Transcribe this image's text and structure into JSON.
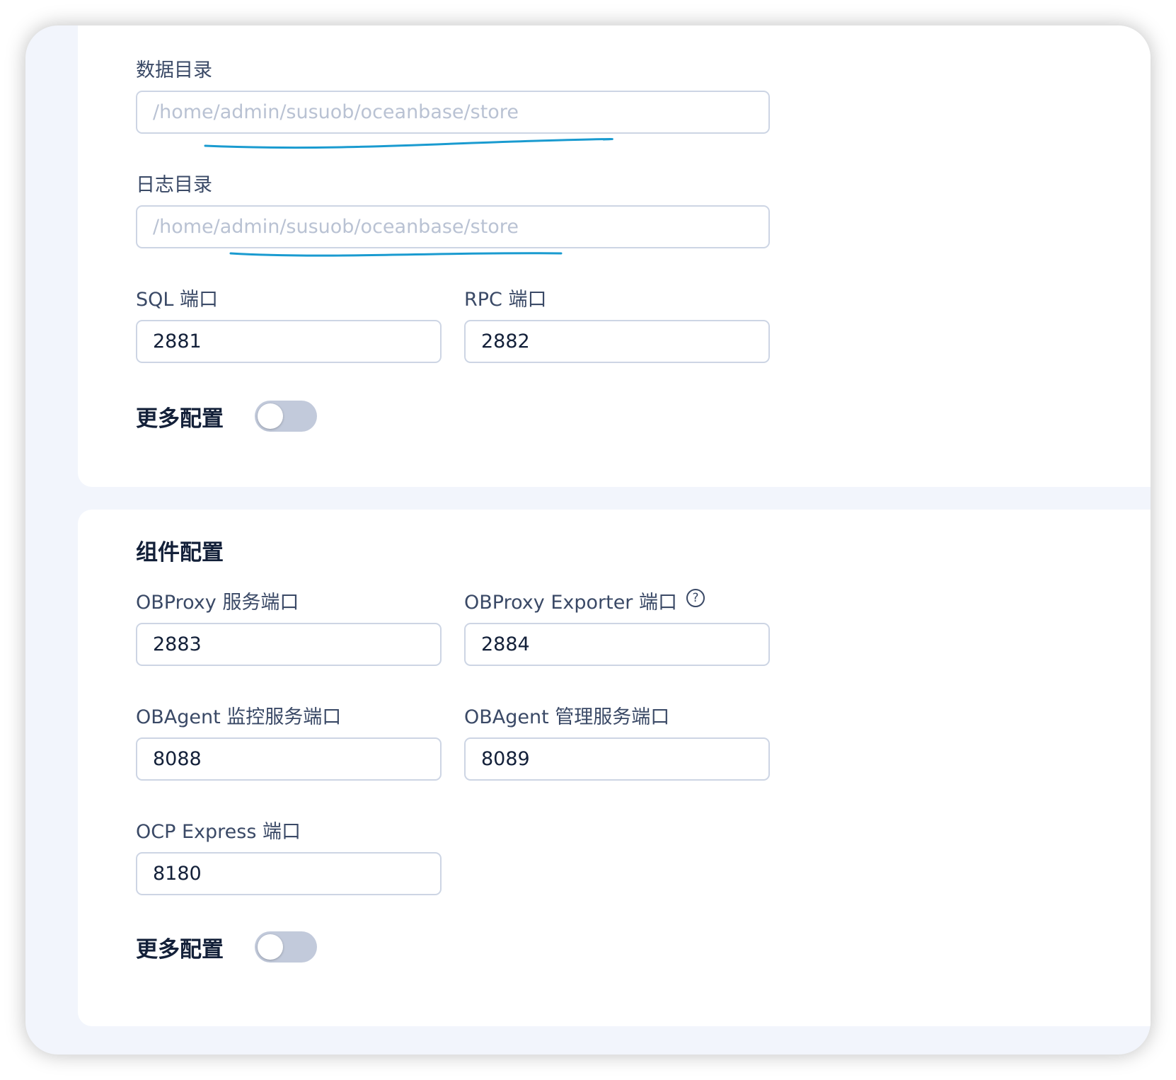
{
  "storage": {
    "data_dir": {
      "label": "数据目录",
      "placeholder": "/home/admin/susuob/oceanbase/store"
    },
    "log_dir": {
      "label": "日志目录",
      "placeholder": "/home/admin/susuob/oceanbase/store"
    },
    "sql_port": {
      "label": "SQL 端口",
      "value": "2881"
    },
    "rpc_port": {
      "label": "RPC 端口",
      "value": "2882"
    },
    "more_config": {
      "label": "更多配置",
      "enabled": false
    }
  },
  "components": {
    "title": "组件配置",
    "obproxy_port": {
      "label": "OBProxy 服务端口",
      "value": "2883"
    },
    "obproxy_exporter_port": {
      "label": "OBProxy Exporter 端口",
      "value": "2884",
      "icon": "question-circle-icon"
    },
    "obagent_monitor_port": {
      "label": "OBAgent 监控服务端口",
      "value": "8088"
    },
    "obagent_manager_port": {
      "label": "OBAgent 管理服务端口",
      "value": "8089"
    },
    "ocp_express_port": {
      "label": "OCP Express 端口",
      "value": "8180"
    },
    "more_config": {
      "label": "更多配置",
      "enabled": false
    }
  },
  "colors": {
    "annotation": "#1a9bd0",
    "toggle_off": "#c2cadb",
    "page_bg": "#f2f5fc"
  }
}
